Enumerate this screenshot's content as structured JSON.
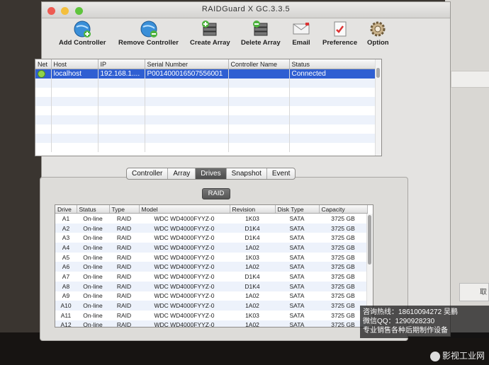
{
  "window": {
    "title": "RAIDGuard X GC.3.3.5"
  },
  "toolbar": [
    {
      "label": "Add Controller"
    },
    {
      "label": "Remove Controller"
    },
    {
      "label": "Create Array"
    },
    {
      "label": "Delete Array"
    },
    {
      "label": "Email"
    },
    {
      "label": "Preference"
    },
    {
      "label": "Option"
    }
  ],
  "hosts": {
    "columns": [
      "Net",
      "Host",
      "IP",
      "Serial Number",
      "Controller Name",
      "Status"
    ],
    "rows": [
      {
        "host": "localhost",
        "ip": "192.168.1....",
        "serial": "P001400016507556001",
        "controller": "",
        "status": "Connected",
        "net_status_color": "#8fd34a"
      }
    ]
  },
  "tabs": [
    "Controller",
    "Array",
    "Drives",
    "Snapshot",
    "Event"
  ],
  "active_tab": "Drives",
  "raid_label": "RAID",
  "drives": {
    "columns": [
      "Drive",
      "Status",
      "Type",
      "Model",
      "Revision",
      "Disk Type",
      "Capacity"
    ],
    "rows": [
      [
        "A1",
        "On-line",
        "RAID",
        "WDC WD4000FYYZ-0",
        "1K03",
        "SATA",
        "3725 GB"
      ],
      [
        "A2",
        "On-line",
        "RAID",
        "WDC WD4000FYYZ-0",
        "D1K4",
        "SATA",
        "3725 GB"
      ],
      [
        "A3",
        "On-line",
        "RAID",
        "WDC WD4000FYYZ-0",
        "D1K4",
        "SATA",
        "3725 GB"
      ],
      [
        "A4",
        "On-line",
        "RAID",
        "WDC WD4000FYYZ-0",
        "1A02",
        "SATA",
        "3725 GB"
      ],
      [
        "A5",
        "On-line",
        "RAID",
        "WDC WD4000FYYZ-0",
        "1K03",
        "SATA",
        "3725 GB"
      ],
      [
        "A6",
        "On-line",
        "RAID",
        "WDC WD4000FYYZ-0",
        "1A02",
        "SATA",
        "3725 GB"
      ],
      [
        "A7",
        "On-line",
        "RAID",
        "WDC WD4000FYYZ-0",
        "D1K4",
        "SATA",
        "3725 GB"
      ],
      [
        "A8",
        "On-line",
        "RAID",
        "WDC WD4000FYYZ-0",
        "D1K4",
        "SATA",
        "3725 GB"
      ],
      [
        "A9",
        "On-line",
        "RAID",
        "WDC WD4000FYYZ-0",
        "1A02",
        "SATA",
        "3725 GB"
      ],
      [
        "A10",
        "On-line",
        "RAID",
        "WDC WD4000FYYZ-0",
        "1A02",
        "SATA",
        "3725 GB"
      ],
      [
        "A11",
        "On-line",
        "RAID",
        "WDC WD4000FYYZ-0",
        "1K03",
        "SATA",
        "3725 GB"
      ],
      [
        "A12",
        "On-line",
        "RAID",
        "WDC WD4000FYYZ-0",
        "1A02",
        "SATA",
        "3725 GB"
      ]
    ]
  },
  "watermark": {
    "line1": "咨询热线：18610094272 吴鹏",
    "line2": "微信QQ：1290928230",
    "line3": "专业销售各种后期制作设备",
    "brand": "影视工业网"
  },
  "colors": {
    "selection": "#2f5fd2",
    "close": "#ee5b52",
    "minimize": "#f4bf3d",
    "zoom": "#5fc43c"
  }
}
